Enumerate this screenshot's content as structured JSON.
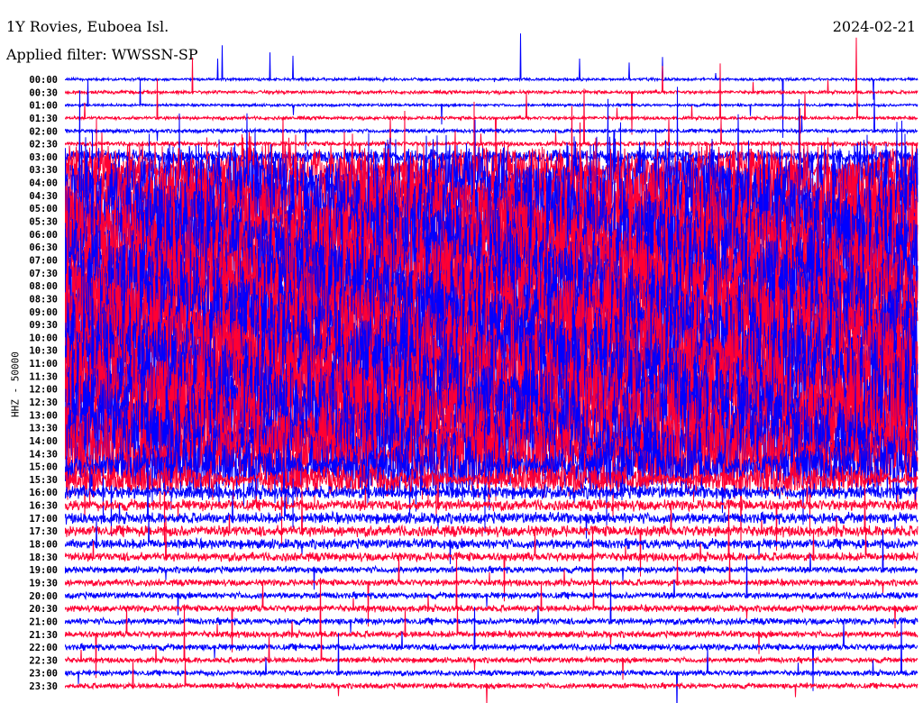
{
  "header": {
    "station": "1Y Rovies, Euboea Isl.",
    "filter": "Applied filter: WWSSN-SP",
    "date": "2024-02-21"
  },
  "chart_data": {
    "type": "line",
    "title": "1Y Rovies, Euboea Isl.",
    "subtitle": "Applied filter: WWSSN-SP",
    "ylabel": "HHZ - 50000",
    "xlabel": "",
    "colors": [
      "#0000ff",
      "#ff0033"
    ],
    "row_labels": [
      "00:00",
      "00:30",
      "01:00",
      "01:30",
      "02:00",
      "02:30",
      "03:00",
      "03:30",
      "04:00",
      "04:30",
      "05:00",
      "05:30",
      "06:00",
      "06:30",
      "07:00",
      "07:30",
      "08:00",
      "08:30",
      "09:00",
      "09:30",
      "10:00",
      "10:30",
      "11:00",
      "11:30",
      "12:00",
      "12:30",
      "13:00",
      "13:30",
      "14:00",
      "14:30",
      "15:00",
      "15:30",
      "16:00",
      "16:30",
      "17:00",
      "17:30",
      "18:00",
      "18:30",
      "19:00",
      "19:30",
      "20:00",
      "20:30",
      "21:00",
      "21:30",
      "22:00",
      "22:30",
      "23:00",
      "23:30"
    ],
    "relative_amplitude": [
      0.25,
      0.3,
      0.25,
      0.3,
      0.35,
      0.4,
      1.2,
      4,
      7,
      8,
      9,
      9,
      9,
      9,
      9,
      9,
      9,
      9,
      9,
      9,
      9,
      9,
      9,
      9,
      9,
      9,
      9,
      9,
      8,
      7,
      5,
      2.5,
      1.2,
      1,
      1,
      1,
      0.9,
      0.8,
      0.6,
      0.6,
      0.6,
      0.6,
      0.6,
      0.6,
      0.6,
      0.5,
      0.5,
      0.5
    ]
  }
}
